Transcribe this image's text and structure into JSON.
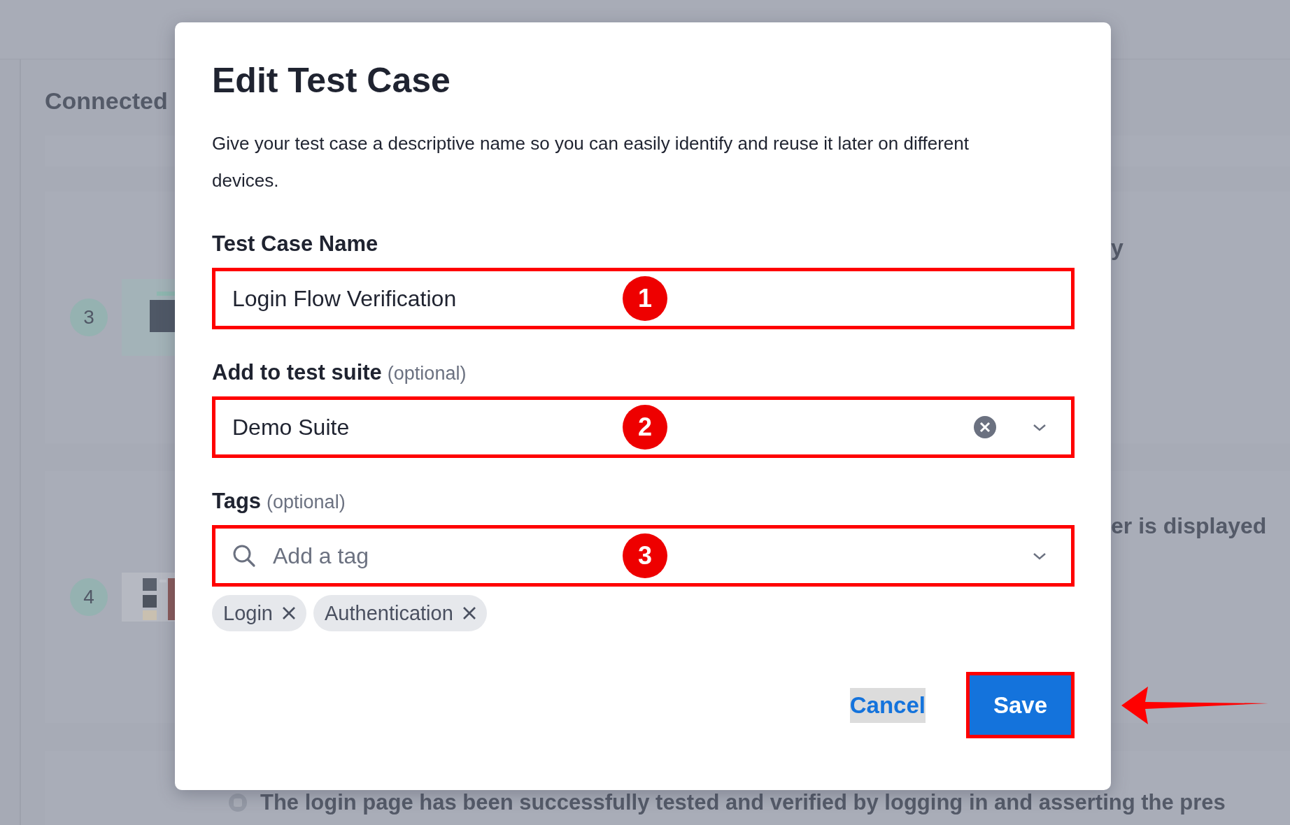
{
  "page": {
    "heading": "Connected",
    "steps": [
      {
        "number": "3",
        "side_text": "y"
      },
      {
        "number": "4",
        "side_text": "er is displayed"
      }
    ],
    "result_text": "The login page has been successfully tested and verified by logging in and asserting the pres"
  },
  "dialog": {
    "title": "Edit Test Case",
    "description": "Give your test case a descriptive name so you can easily identify and reuse it later on different devices.",
    "fields": [
      {
        "kind": "text",
        "label": "Test Case Name",
        "value": "Login Flow Verification",
        "highlighted": true,
        "marker": "1"
      },
      {
        "kind": "select",
        "label": "Add to test suite",
        "hint": "(optional)",
        "value": "Demo Suite",
        "highlighted": true,
        "marker": "2"
      },
      {
        "kind": "tags",
        "label": "Tags",
        "hint": "(optional)",
        "placeholder": "Add a tag",
        "highlighted": true,
        "marker": "3",
        "tags": [
          "Login",
          "Authentication"
        ]
      }
    ],
    "buttons": [
      {
        "kind": "link",
        "label": "Cancel",
        "focused": true,
        "highlighted": false
      },
      {
        "kind": "primary",
        "label": "Save",
        "focused": false,
        "highlighted": true,
        "pointer_arrow": true
      }
    ]
  }
}
